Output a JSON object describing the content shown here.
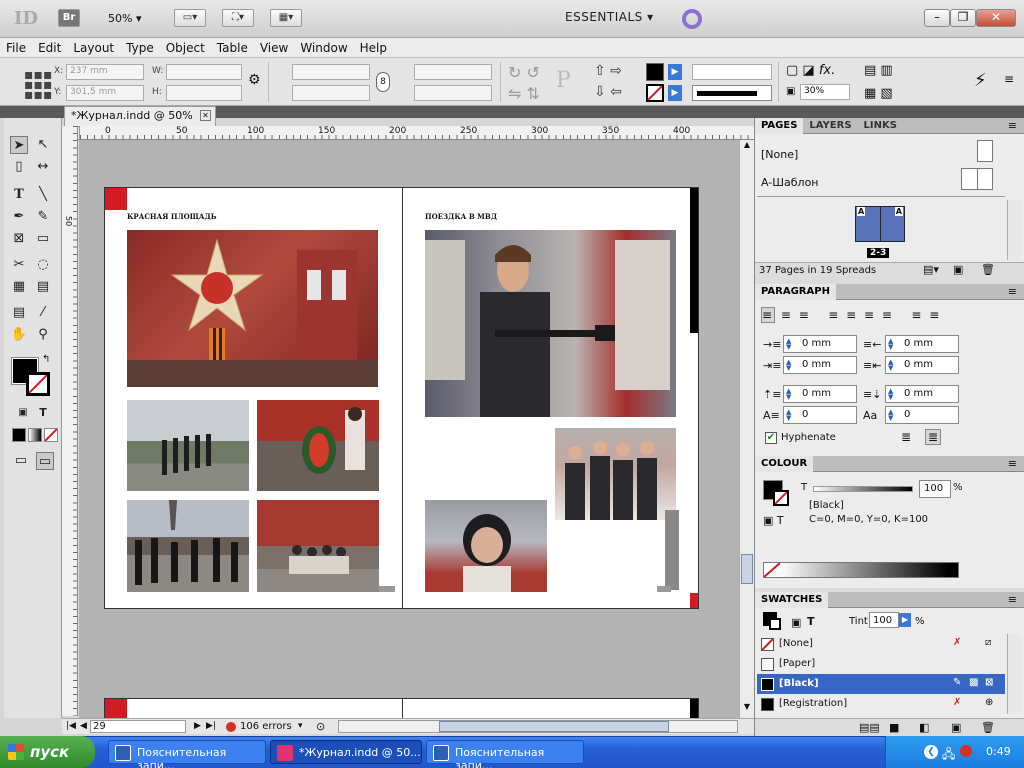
{
  "appbar": {
    "logo": "ID",
    "bridge": "Br",
    "zoom": "50%",
    "workspace": "ESSENTIALS"
  },
  "menu": [
    "File",
    "Edit",
    "Layout",
    "Type",
    "Object",
    "Table",
    "View",
    "Window",
    "Help"
  ],
  "control": {
    "x_label": "X:",
    "x_value": "237 mm",
    "y_label": "Y:",
    "y_value": "301,5 mm",
    "w_label": "W:",
    "h_label": "H:",
    "opacity": "30%"
  },
  "document_tab": "*Журнал.indd @ 50%",
  "ruler": {
    "marks": [
      "0",
      "50",
      "100",
      "150",
      "200",
      "250",
      "300",
      "350",
      "400"
    ],
    "left_mark": "50"
  },
  "spread": {
    "left_heading": "КРАСНАЯ ПЛОЩАДЬ",
    "right_heading": "ПОЕЗДКА В МВД"
  },
  "status": {
    "page": "29",
    "errors": "106 errors"
  },
  "panels": {
    "pages": {
      "tabs": [
        "PAGES",
        "LAYERS",
        "LINKS"
      ],
      "none_master": "[None]",
      "a_master": "A-Шаблон",
      "spread_label": "2-3",
      "master_letter": "A",
      "summary": "37 Pages in 19 Spreads"
    },
    "paragraph": {
      "title": "PARAGRAPH",
      "left_indent": "0 mm",
      "right_indent": "0 mm",
      "first_indent": "0 mm",
      "last_indent": "0 mm",
      "space_before": "0 mm",
      "space_after": "0 mm",
      "drop_lines": "0",
      "drop_chars": "0",
      "hyphenate": "Hyphenate"
    },
    "colour": {
      "title": "COLOUR",
      "t_label": "T",
      "tint": "100",
      "percent": "%",
      "swatch_name": "[Black]",
      "cmyk": "C=0, M=0, Y=0, K=100"
    },
    "swatches": {
      "title": "SWATCHES",
      "t_label": "T",
      "tint_label": "Tint:",
      "tint": "100",
      "percent": "%",
      "items": [
        {
          "name": "[None]",
          "color": "#ffffff"
        },
        {
          "name": "[Paper]",
          "color": "#ffffff"
        },
        {
          "name": "[Black]",
          "color": "#000000"
        },
        {
          "name": "[Registration]",
          "color": "#000000"
        }
      ]
    }
  },
  "taskbar": {
    "start": "пуск",
    "tasks": [
      "Пояснительная запи...",
      "*Журнал.indd @ 50...",
      "Пояснительная запи..."
    ],
    "lang": "RU",
    "clock": "0:49"
  },
  "colors": {
    "accent_red": "#d21c24",
    "selection_blue": "#3767c4",
    "taskbar_blue": "#245edb"
  }
}
